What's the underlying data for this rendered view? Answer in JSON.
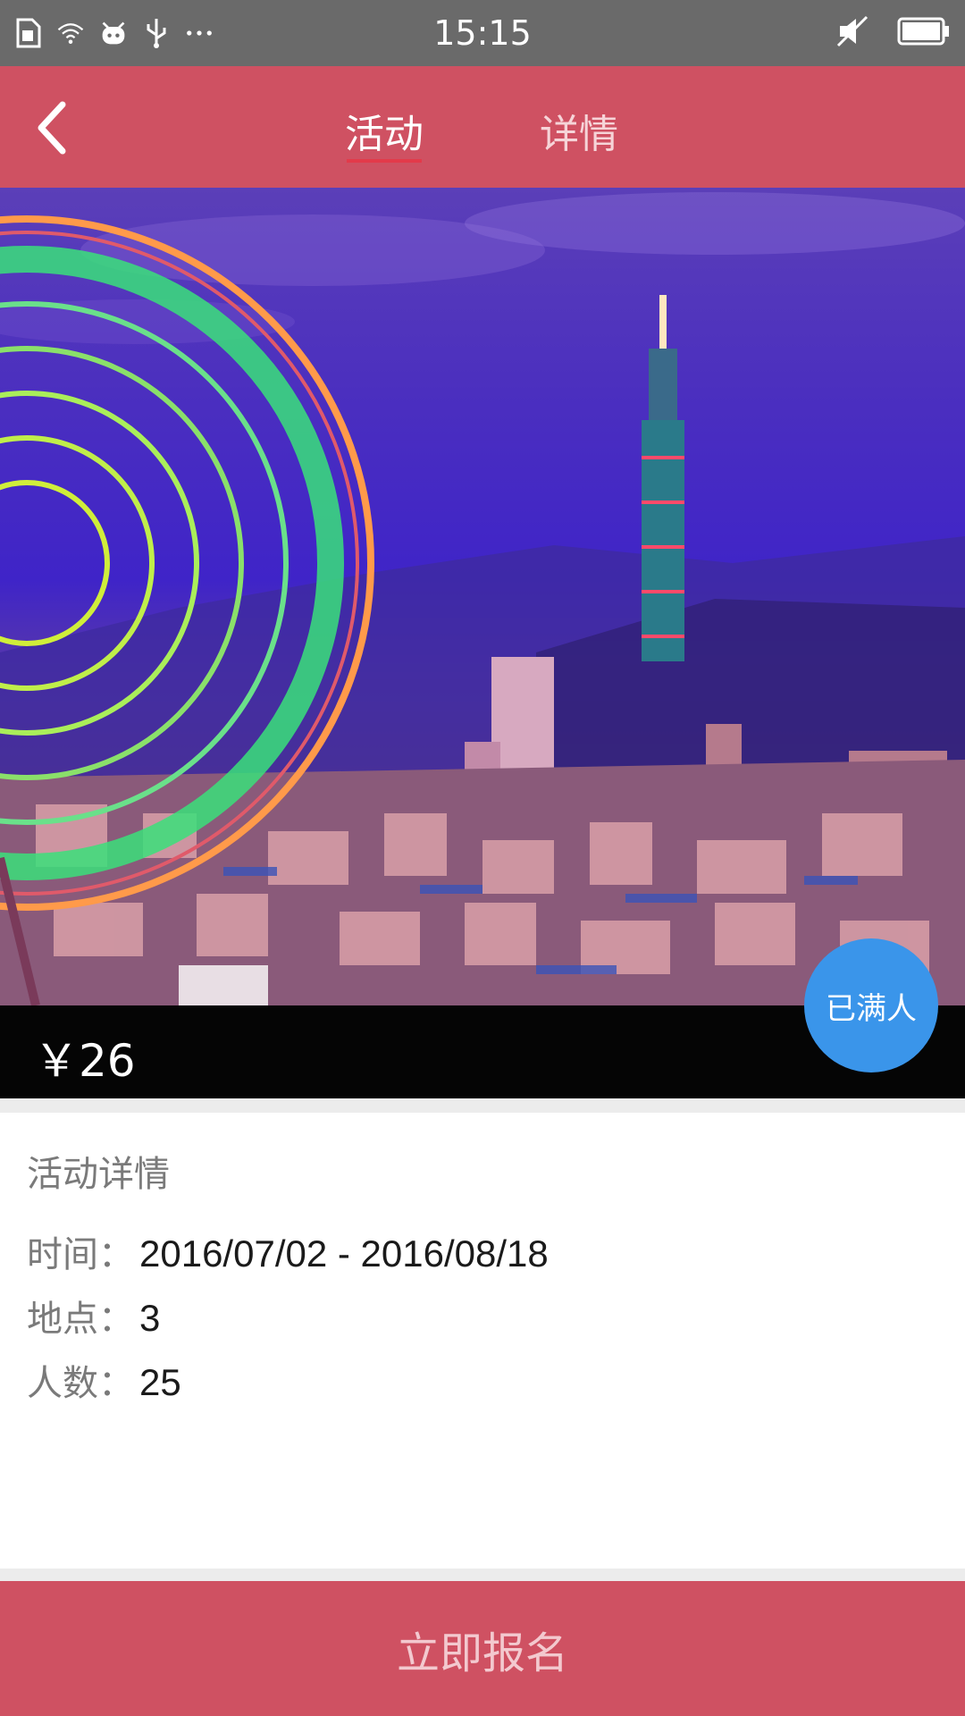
{
  "status_bar": {
    "time": "15:15",
    "icons_left": [
      "sim-card-icon",
      "wifi-icon",
      "android-icon",
      "usb-icon",
      "more-icon"
    ],
    "icons_right": [
      "sound-muted-icon",
      "battery-icon"
    ]
  },
  "header": {
    "back_icon": "chevron-left-icon",
    "tabs": [
      {
        "label": "活动",
        "active": true
      },
      {
        "label": "详情",
        "active": false
      }
    ],
    "background_color": "#cf5162"
  },
  "banner": {
    "price": "￥26",
    "status_badge": "已满人",
    "badge_color": "#3a95ea"
  },
  "details": {
    "title": "活动详情",
    "rows": [
      {
        "label": "时间：",
        "value": "2016/07/02 - 2016/08/18"
      },
      {
        "label": "地点：",
        "value": "3"
      },
      {
        "label": "人数：",
        "value": "25"
      }
    ]
  },
  "footer": {
    "register_label": "立即报名",
    "background_color": "#cf5162"
  }
}
